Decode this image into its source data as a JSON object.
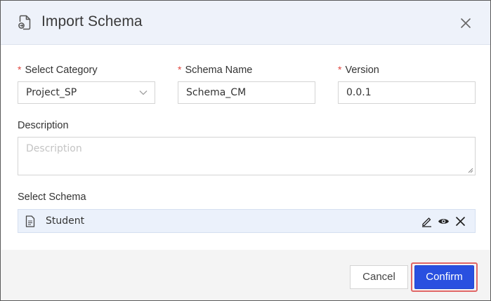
{
  "dialog": {
    "title": "Import Schema",
    "icon": "document-import-icon"
  },
  "form": {
    "category": {
      "label": "Select Category",
      "required_mark": "*",
      "value": "Project_SP"
    },
    "schema_name": {
      "label": "Schema Name",
      "required_mark": "*",
      "value": "Schema_CM"
    },
    "version": {
      "label": "Version",
      "required_mark": "*",
      "value": "0.0.1"
    },
    "description": {
      "label": "Description",
      "placeholder": "Description",
      "value": ""
    },
    "select_schema": {
      "label": "Select Schema",
      "files": [
        {
          "name": "Student"
        }
      ]
    }
  },
  "footer": {
    "cancel_label": "Cancel",
    "confirm_label": "Confirm"
  },
  "colors": {
    "accent": "#2950e0",
    "required": "#e0463f",
    "highlight_outline": "#e06666",
    "header_bg": "#eef2fa",
    "schema_row_bg": "#ebf1fb"
  }
}
